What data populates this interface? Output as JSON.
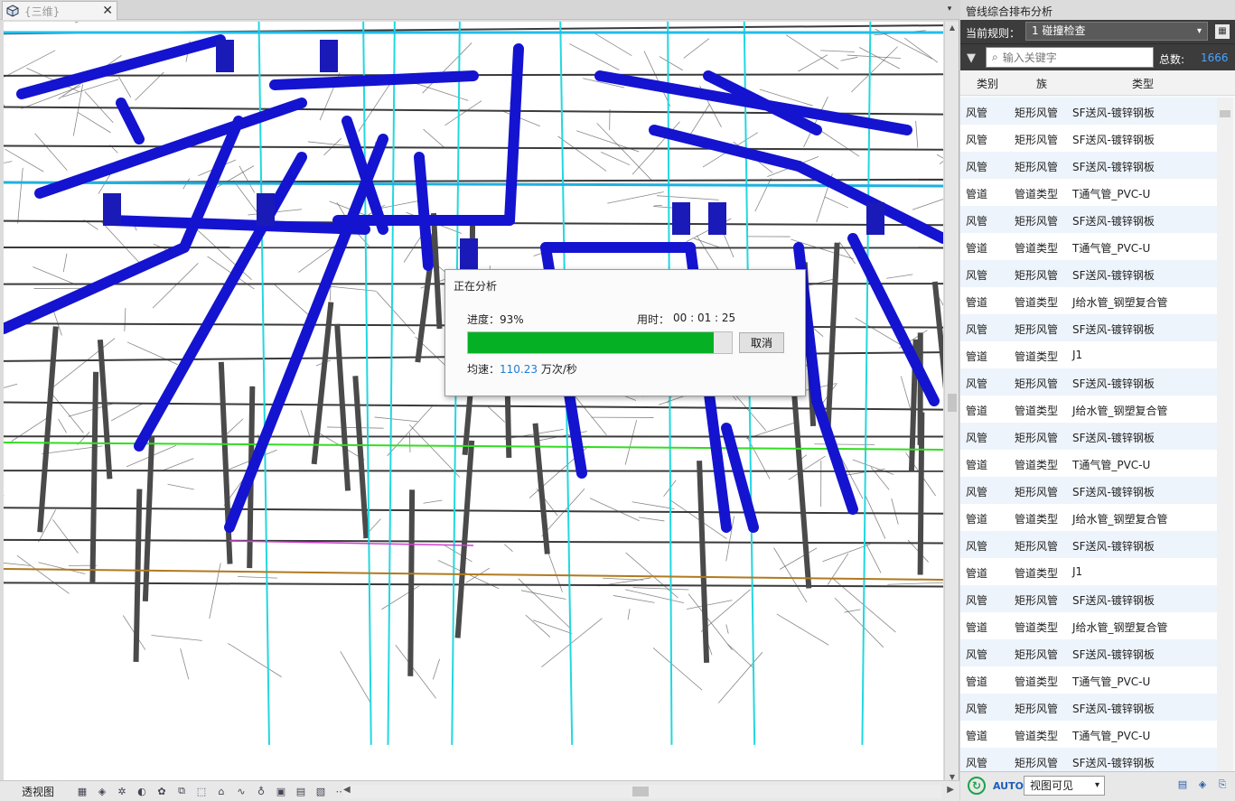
{
  "view_tab": {
    "label": "{三维}",
    "close": "✕",
    "dropdown": "▾"
  },
  "status": {
    "view_label": "透视图"
  },
  "dialog": {
    "title": "正在分析",
    "progress_label": "进度：93%",
    "progress": 0.93,
    "time_label": "用时：",
    "time_value": "00 : 01 : 25",
    "cancel_label": "取消",
    "speed_label": "均速：",
    "speed_value": "110.23",
    "speed_unit": " 万次/秒"
  },
  "panel": {
    "title": "管线综合排布分析",
    "rule_label": "当前规则：",
    "rule_value": "1 碰撞检查",
    "search_placeholder": "输入关键字",
    "total_label": "总数:",
    "total_value": "1666",
    "columns": [
      "类别",
      "族",
      "类型"
    ],
    "rows": [
      [
        "风管",
        "矩形风管",
        "SF送风-镀锌钢板"
      ],
      [
        "风管",
        "矩形风管",
        "SF送风-镀锌钢板"
      ],
      [
        "风管",
        "矩形风管",
        "SF送风-镀锌钢板"
      ],
      [
        "管道",
        "管道类型",
        "T通气管_PVC-U"
      ],
      [
        "风管",
        "矩形风管",
        "SF送风-镀锌钢板"
      ],
      [
        "管道",
        "管道类型",
        "T通气管_PVC-U"
      ],
      [
        "风管",
        "矩形风管",
        "SF送风-镀锌钢板"
      ],
      [
        "管道",
        "管道类型",
        "J给水管_钢塑复合管"
      ],
      [
        "风管",
        "矩形风管",
        "SF送风-镀锌钢板"
      ],
      [
        "管道",
        "管道类型",
        "J1"
      ],
      [
        "风管",
        "矩形风管",
        "SF送风-镀锌钢板"
      ],
      [
        "管道",
        "管道类型",
        "J给水管_钢塑复合管"
      ],
      [
        "风管",
        "矩形风管",
        "SF送风-镀锌钢板"
      ],
      [
        "管道",
        "管道类型",
        "T通气管_PVC-U"
      ],
      [
        "风管",
        "矩形风管",
        "SF送风-镀锌钢板"
      ],
      [
        "管道",
        "管道类型",
        "J给水管_钢塑复合管"
      ],
      [
        "风管",
        "矩形风管",
        "SF送风-镀锌钢板"
      ],
      [
        "管道",
        "管道类型",
        "J1"
      ],
      [
        "风管",
        "矩形风管",
        "SF送风-镀锌钢板"
      ],
      [
        "管道",
        "管道类型",
        "J给水管_钢塑复合管"
      ],
      [
        "风管",
        "矩形风管",
        "SF送风-镀锌钢板"
      ],
      [
        "管道",
        "管道类型",
        "T通气管_PVC-U"
      ],
      [
        "风管",
        "矩形风管",
        "SF送风-镀锌钢板"
      ],
      [
        "管道",
        "管道类型",
        "T通气管_PVC-U"
      ],
      [
        "风管",
        "矩形风管",
        "SF送风-镀锌钢板"
      ]
    ],
    "auto_label": "AUTO",
    "visibility_value": "视图可见"
  },
  "colors": {
    "duct_blue": "#1414d0",
    "pipe_cyan": "#22d8e0",
    "progress_green": "#06b025",
    "accent_blue": "#4aa3ff"
  }
}
